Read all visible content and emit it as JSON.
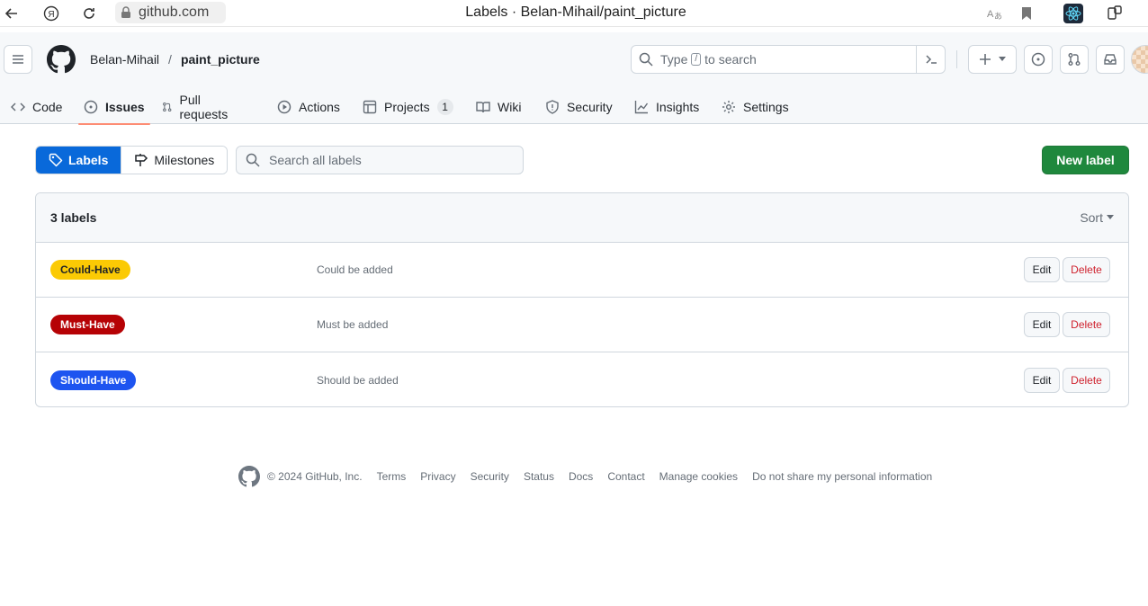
{
  "browser": {
    "url": "github.com",
    "title": "Labels · Belan-Mihail/paint_picture"
  },
  "header": {
    "owner": "Belan-Mihail",
    "separator": "/",
    "repo": "paint_picture",
    "search": {
      "prefix": "Type",
      "key": "/",
      "suffix": "to search"
    }
  },
  "tabs": [
    {
      "label": "Code"
    },
    {
      "label": "Issues"
    },
    {
      "label": "Pull requests"
    },
    {
      "label": "Actions"
    },
    {
      "label": "Projects",
      "count": "1"
    },
    {
      "label": "Wiki"
    },
    {
      "label": "Security"
    },
    {
      "label": "Insights"
    },
    {
      "label": "Settings"
    }
  ],
  "subnav": {
    "labels": "Labels",
    "milestones": "Milestones",
    "search_placeholder": "Search all labels",
    "new_label": "New label"
  },
  "labels_box": {
    "count_text": "3 labels",
    "sort": "Sort",
    "edit": "Edit",
    "delete": "Delete",
    "rows": [
      {
        "name": "Could-Have",
        "description": "Could be added",
        "color": "#fbca04",
        "text_color": "#1f2328"
      },
      {
        "name": "Must-Have",
        "description": "Must be added",
        "color": "#b60205",
        "text_color": "#ffffff"
      },
      {
        "name": "Should-Have",
        "description": "Should be added",
        "color": "#1d54f0",
        "text_color": "#ffffff"
      }
    ]
  },
  "footer": {
    "copyright": "© 2024 GitHub, Inc.",
    "links": [
      "Terms",
      "Privacy",
      "Security",
      "Status",
      "Docs",
      "Contact",
      "Manage cookies",
      "Do not share my personal information"
    ]
  },
  "colors": {
    "primary_blue": "#0969da",
    "green": "#1f883d",
    "active_tab_underline": "#fd8c73",
    "danger": "#cf222e"
  }
}
